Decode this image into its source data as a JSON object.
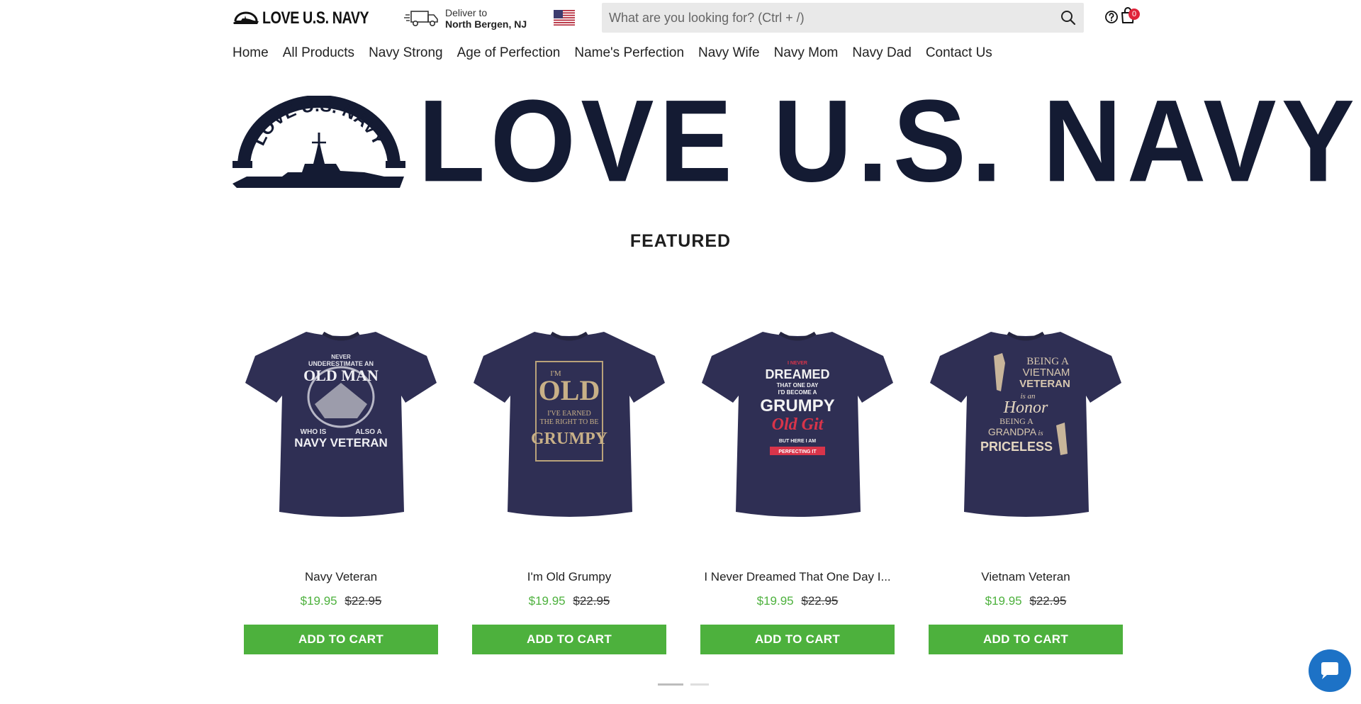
{
  "header": {
    "logo_text": "LOVE U.S. NAVY",
    "deliver_label": "Deliver to",
    "deliver_city": "North Bergen, NJ",
    "search_placeholder": "What are you looking for? (Ctrl + /)",
    "cart_count": "0",
    "icons": [
      "truck-icon",
      "us-flag-icon",
      "search-icon",
      "help-icon",
      "cart-icon"
    ]
  },
  "nav": {
    "items": [
      "Home",
      "All Products",
      "Navy Strong",
      "Age of Perfection",
      "Name's Perfection",
      "Navy Wife",
      "Navy Mom",
      "Navy Dad",
      "Contact Us"
    ]
  },
  "banner": {
    "text": "LOVE U.S. NAVY",
    "arc_text": "LOVE U.S. NAVY"
  },
  "featured": {
    "title": "FEATURED",
    "products": [
      {
        "name": "Navy Veteran",
        "price": "$19.95",
        "old_price": "$22.95",
        "button": "ADD TO CART",
        "print_lines": [
          "NEVER",
          "UNDERESTIMATE AN",
          "OLD MAN",
          "WHO IS",
          "ALSO A",
          "NAVY VETERAN"
        ]
      },
      {
        "name": "I'm Old Grumpy",
        "price": "$19.95",
        "old_price": "$22.95",
        "button": "ADD TO CART",
        "print_lines": [
          "I'M",
          "OLD",
          "I'VE EARNED",
          "THE RIGHT TO BE",
          "GRUMPY"
        ]
      },
      {
        "name": "I Never Dreamed That One Day I...",
        "price": "$19.95",
        "old_price": "$22.95",
        "button": "ADD TO CART",
        "print_lines": [
          "I NEVER",
          "DREAMED",
          "THAT ONE DAY",
          "I'D BECOME A",
          "GRUMPY",
          "Old Git",
          "BUT HERE I AM",
          "PERFECTING IT"
        ]
      },
      {
        "name": "Vietnam Veteran",
        "price": "$19.95",
        "old_price": "$22.95",
        "button": "ADD TO CART",
        "print_lines": [
          "BEING A",
          "VIETNAM",
          "VETERAN",
          "is an",
          "Honor",
          "BEING A",
          "GRANDPA",
          "is",
          "PRICELESS"
        ]
      }
    ]
  },
  "colors": {
    "accent_green": "#4db13d",
    "navy_text": "#141b33",
    "shirt_navy": "#2f2f54",
    "badge_red": "#e0243a",
    "chat_blue": "#1d72c6"
  },
  "chat": {
    "icon": "chat-bubble-icon"
  }
}
